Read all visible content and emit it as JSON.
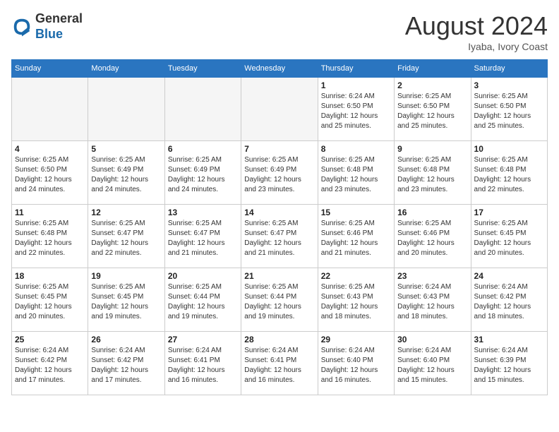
{
  "header": {
    "logo_general": "General",
    "logo_blue": "Blue",
    "month_year": "August 2024",
    "location": "Iyaba, Ivory Coast"
  },
  "days_of_week": [
    "Sunday",
    "Monday",
    "Tuesday",
    "Wednesday",
    "Thursday",
    "Friday",
    "Saturday"
  ],
  "weeks": [
    [
      {
        "day": "",
        "info": ""
      },
      {
        "day": "",
        "info": ""
      },
      {
        "day": "",
        "info": ""
      },
      {
        "day": "",
        "info": ""
      },
      {
        "day": "1",
        "info": "Sunrise: 6:24 AM\nSunset: 6:50 PM\nDaylight: 12 hours\nand 25 minutes."
      },
      {
        "day": "2",
        "info": "Sunrise: 6:25 AM\nSunset: 6:50 PM\nDaylight: 12 hours\nand 25 minutes."
      },
      {
        "day": "3",
        "info": "Sunrise: 6:25 AM\nSunset: 6:50 PM\nDaylight: 12 hours\nand 25 minutes."
      }
    ],
    [
      {
        "day": "4",
        "info": "Sunrise: 6:25 AM\nSunset: 6:50 PM\nDaylight: 12 hours\nand 24 minutes."
      },
      {
        "day": "5",
        "info": "Sunrise: 6:25 AM\nSunset: 6:49 PM\nDaylight: 12 hours\nand 24 minutes."
      },
      {
        "day": "6",
        "info": "Sunrise: 6:25 AM\nSunset: 6:49 PM\nDaylight: 12 hours\nand 24 minutes."
      },
      {
        "day": "7",
        "info": "Sunrise: 6:25 AM\nSunset: 6:49 PM\nDaylight: 12 hours\nand 23 minutes."
      },
      {
        "day": "8",
        "info": "Sunrise: 6:25 AM\nSunset: 6:48 PM\nDaylight: 12 hours\nand 23 minutes."
      },
      {
        "day": "9",
        "info": "Sunrise: 6:25 AM\nSunset: 6:48 PM\nDaylight: 12 hours\nand 23 minutes."
      },
      {
        "day": "10",
        "info": "Sunrise: 6:25 AM\nSunset: 6:48 PM\nDaylight: 12 hours\nand 22 minutes."
      }
    ],
    [
      {
        "day": "11",
        "info": "Sunrise: 6:25 AM\nSunset: 6:48 PM\nDaylight: 12 hours\nand 22 minutes."
      },
      {
        "day": "12",
        "info": "Sunrise: 6:25 AM\nSunset: 6:47 PM\nDaylight: 12 hours\nand 22 minutes."
      },
      {
        "day": "13",
        "info": "Sunrise: 6:25 AM\nSunset: 6:47 PM\nDaylight: 12 hours\nand 21 minutes."
      },
      {
        "day": "14",
        "info": "Sunrise: 6:25 AM\nSunset: 6:47 PM\nDaylight: 12 hours\nand 21 minutes."
      },
      {
        "day": "15",
        "info": "Sunrise: 6:25 AM\nSunset: 6:46 PM\nDaylight: 12 hours\nand 21 minutes."
      },
      {
        "day": "16",
        "info": "Sunrise: 6:25 AM\nSunset: 6:46 PM\nDaylight: 12 hours\nand 20 minutes."
      },
      {
        "day": "17",
        "info": "Sunrise: 6:25 AM\nSunset: 6:45 PM\nDaylight: 12 hours\nand 20 minutes."
      }
    ],
    [
      {
        "day": "18",
        "info": "Sunrise: 6:25 AM\nSunset: 6:45 PM\nDaylight: 12 hours\nand 20 minutes."
      },
      {
        "day": "19",
        "info": "Sunrise: 6:25 AM\nSunset: 6:45 PM\nDaylight: 12 hours\nand 19 minutes."
      },
      {
        "day": "20",
        "info": "Sunrise: 6:25 AM\nSunset: 6:44 PM\nDaylight: 12 hours\nand 19 minutes."
      },
      {
        "day": "21",
        "info": "Sunrise: 6:25 AM\nSunset: 6:44 PM\nDaylight: 12 hours\nand 19 minutes."
      },
      {
        "day": "22",
        "info": "Sunrise: 6:25 AM\nSunset: 6:43 PM\nDaylight: 12 hours\nand 18 minutes."
      },
      {
        "day": "23",
        "info": "Sunrise: 6:24 AM\nSunset: 6:43 PM\nDaylight: 12 hours\nand 18 minutes."
      },
      {
        "day": "24",
        "info": "Sunrise: 6:24 AM\nSunset: 6:42 PM\nDaylight: 12 hours\nand 18 minutes."
      }
    ],
    [
      {
        "day": "25",
        "info": "Sunrise: 6:24 AM\nSunset: 6:42 PM\nDaylight: 12 hours\nand 17 minutes."
      },
      {
        "day": "26",
        "info": "Sunrise: 6:24 AM\nSunset: 6:42 PM\nDaylight: 12 hours\nand 17 minutes."
      },
      {
        "day": "27",
        "info": "Sunrise: 6:24 AM\nSunset: 6:41 PM\nDaylight: 12 hours\nand 16 minutes."
      },
      {
        "day": "28",
        "info": "Sunrise: 6:24 AM\nSunset: 6:41 PM\nDaylight: 12 hours\nand 16 minutes."
      },
      {
        "day": "29",
        "info": "Sunrise: 6:24 AM\nSunset: 6:40 PM\nDaylight: 12 hours\nand 16 minutes."
      },
      {
        "day": "30",
        "info": "Sunrise: 6:24 AM\nSunset: 6:40 PM\nDaylight: 12 hours\nand 15 minutes."
      },
      {
        "day": "31",
        "info": "Sunrise: 6:24 AM\nSunset: 6:39 PM\nDaylight: 12 hours\nand 15 minutes."
      }
    ]
  ]
}
